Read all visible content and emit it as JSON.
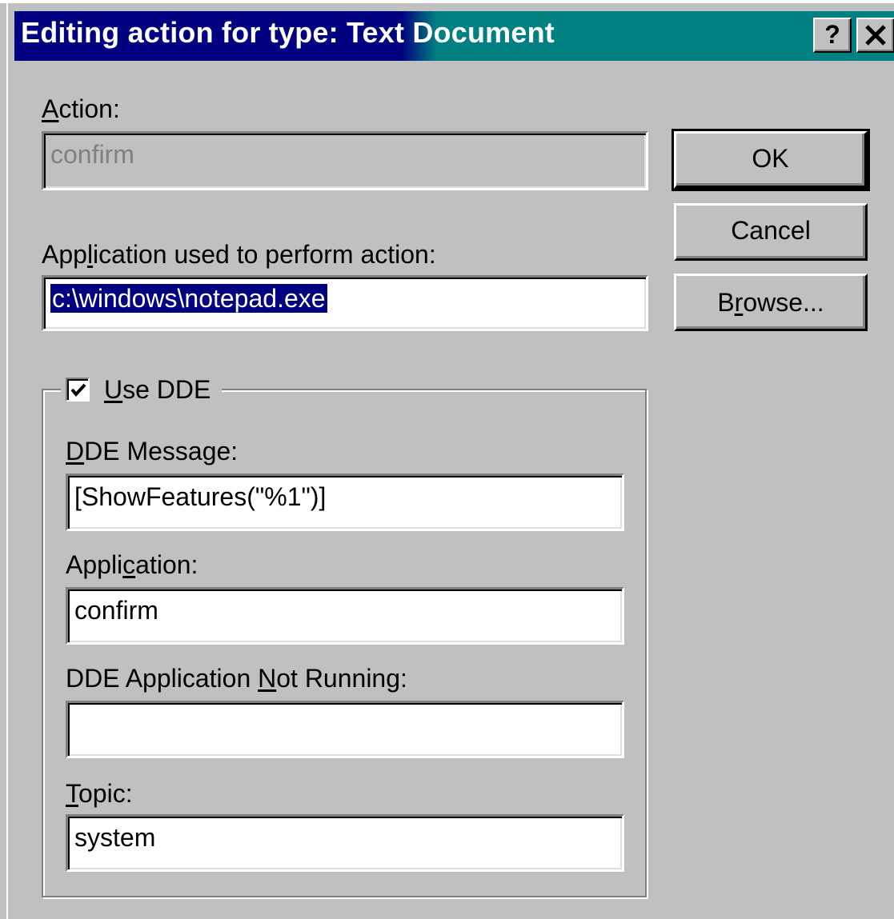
{
  "window": {
    "title": "Editing action for type: Text Document",
    "help_button": "?",
    "close_button": "✕"
  },
  "action": {
    "label_prefix": "A",
    "label_rest": "ction:",
    "value": "confirm"
  },
  "application_path": {
    "label_pre": "App",
    "label_u": "l",
    "label_post": "ication used to perform action:",
    "value": "c:\\windows\\notepad.exe"
  },
  "buttons": {
    "ok": "OK",
    "cancel": "Cancel",
    "browse_pre": "B",
    "browse_u": "r",
    "browse_post": "owse..."
  },
  "dde": {
    "use_dde_u": "U",
    "use_dde_rest": "se DDE",
    "use_dde_checked": true,
    "message_label_u": "D",
    "message_label_rest": "DE Message:",
    "message_value": "[ShowFeatures(\"%1\")]",
    "application_label_pre": "Appli",
    "application_label_u": "c",
    "application_label_post": "ation:",
    "application_value": "confirm",
    "not_running_label_pre": "DDE Application ",
    "not_running_label_u": "N",
    "not_running_label_post": "ot Running:",
    "not_running_value": "",
    "topic_label_u": "T",
    "topic_label_rest": "opic:",
    "topic_value": "system"
  }
}
